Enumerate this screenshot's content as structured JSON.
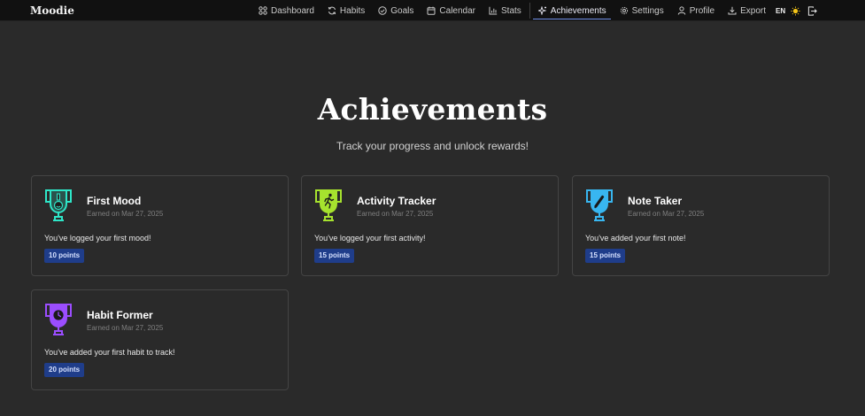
{
  "app": {
    "brand": "Moodie"
  },
  "nav": {
    "items": [
      {
        "label": "Dashboard",
        "icon": "dashboard-icon"
      },
      {
        "label": "Habits",
        "icon": "refresh-icon"
      },
      {
        "label": "Goals",
        "icon": "check-circle-icon"
      },
      {
        "label": "Calendar",
        "icon": "calendar-icon"
      },
      {
        "label": "Stats",
        "icon": "bar-chart-icon"
      },
      {
        "label": "Achievements",
        "icon": "sparkles-icon",
        "active": true
      },
      {
        "label": "Settings",
        "icon": "gear-icon"
      },
      {
        "label": "Profile",
        "icon": "user-icon"
      },
      {
        "label": "Export",
        "icon": "download-icon"
      }
    ],
    "language": "EN",
    "theme_icon": "sun-icon",
    "logout_icon": "logout-icon"
  },
  "page": {
    "title": "Achievements",
    "subtitle": "Track your progress and unlock rewards!"
  },
  "achievements": [
    {
      "name": "First Mood",
      "earned": "Earned on Mar 27, 2025",
      "description": "You've logged your first mood!",
      "points": "10 points",
      "color": "#2ee6c8",
      "icon": "smile-trophy-icon"
    },
    {
      "name": "Activity Tracker",
      "earned": "Earned on Mar 27, 2025",
      "description": "You've logged your first activity!",
      "points": "15 points",
      "color": "#a6e22e",
      "icon": "runner-trophy-icon"
    },
    {
      "name": "Note Taker",
      "earned": "Earned on Mar 27, 2025",
      "description": "You've added your first note!",
      "points": "15 points",
      "color": "#38b6f0",
      "icon": "pencil-trophy-icon"
    },
    {
      "name": "Habit Former",
      "earned": "Earned on Mar 27, 2025",
      "description": "You've added your first habit to track!",
      "points": "20 points",
      "color": "#9b4dff",
      "icon": "clock-trophy-icon"
    }
  ],
  "colors": {
    "background": "#2a2a2a",
    "topbar": "#111111",
    "badge": "#1f3d8a",
    "active_underline": "#6f8fe8"
  }
}
